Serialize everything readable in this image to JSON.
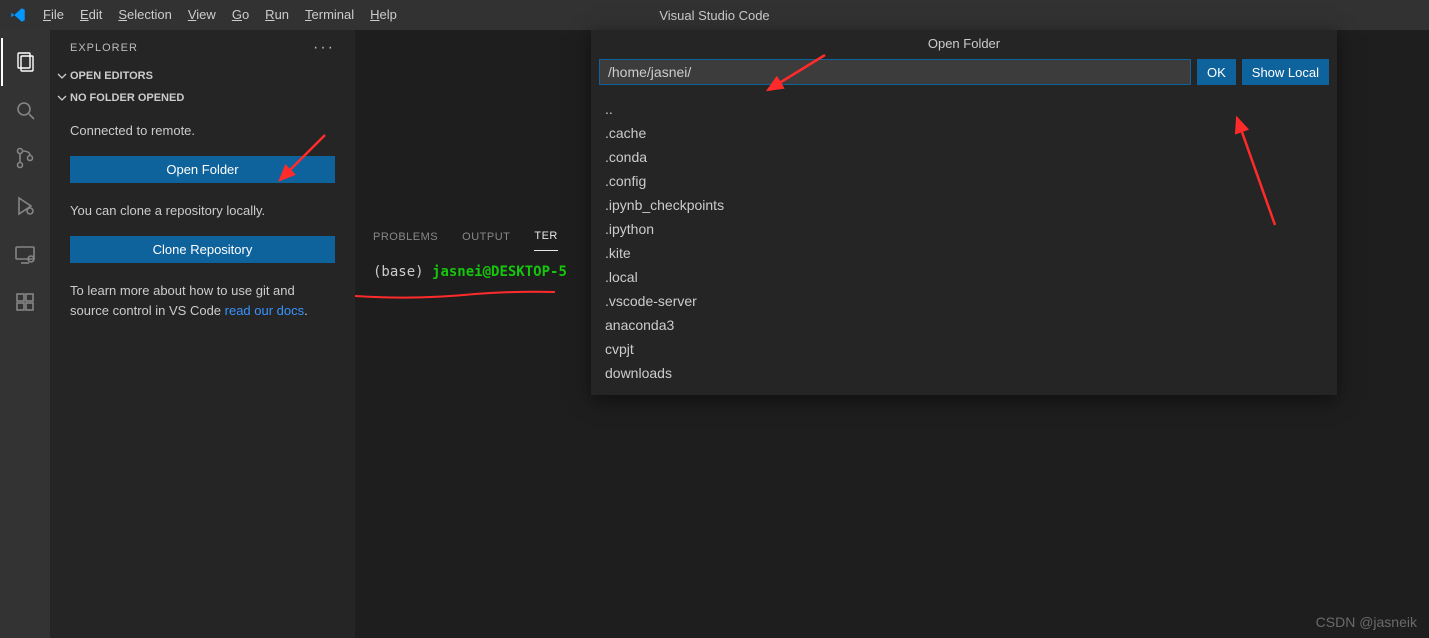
{
  "titlebar": {
    "app_title": "Visual Studio Code",
    "menu": [
      "File",
      "Edit",
      "Selection",
      "View",
      "Go",
      "Run",
      "Terminal",
      "Help"
    ]
  },
  "activity": {
    "items": [
      "explorer",
      "search",
      "source-control",
      "run-debug",
      "remote-explorer",
      "extensions"
    ]
  },
  "explorer": {
    "title": "EXPLORER",
    "open_editors_label": "OPEN EDITORS",
    "no_folder_label": "NO FOLDER OPENED",
    "connected_text": "Connected to remote.",
    "open_folder_btn": "Open Folder",
    "clone_text": "You can clone a repository locally.",
    "clone_btn": "Clone Repository",
    "learn_text_1": "To learn more about how to use git and source control in VS Code ",
    "learn_link": "read our docs",
    "learn_text_2": "."
  },
  "panel": {
    "tabs": [
      "PROBLEMS",
      "OUTPUT",
      "TERMINAL"
    ],
    "active_tab_index": 2,
    "terminal": {
      "base_prefix": "(base) ",
      "user_host": "jasnei@DESKTOP-5"
    }
  },
  "quickopen": {
    "title": "Open Folder",
    "input_value": "/home/jasnei/",
    "ok_label": "OK",
    "show_local_label": "Show Local",
    "items": [
      "..",
      ".cache",
      ".conda",
      ".config",
      ".ipynb_checkpoints",
      ".ipython",
      ".kite",
      ".local",
      ".vscode-server",
      "anaconda3",
      "cvpjt",
      "downloads"
    ]
  },
  "watermark": "CSDN @jasneik"
}
